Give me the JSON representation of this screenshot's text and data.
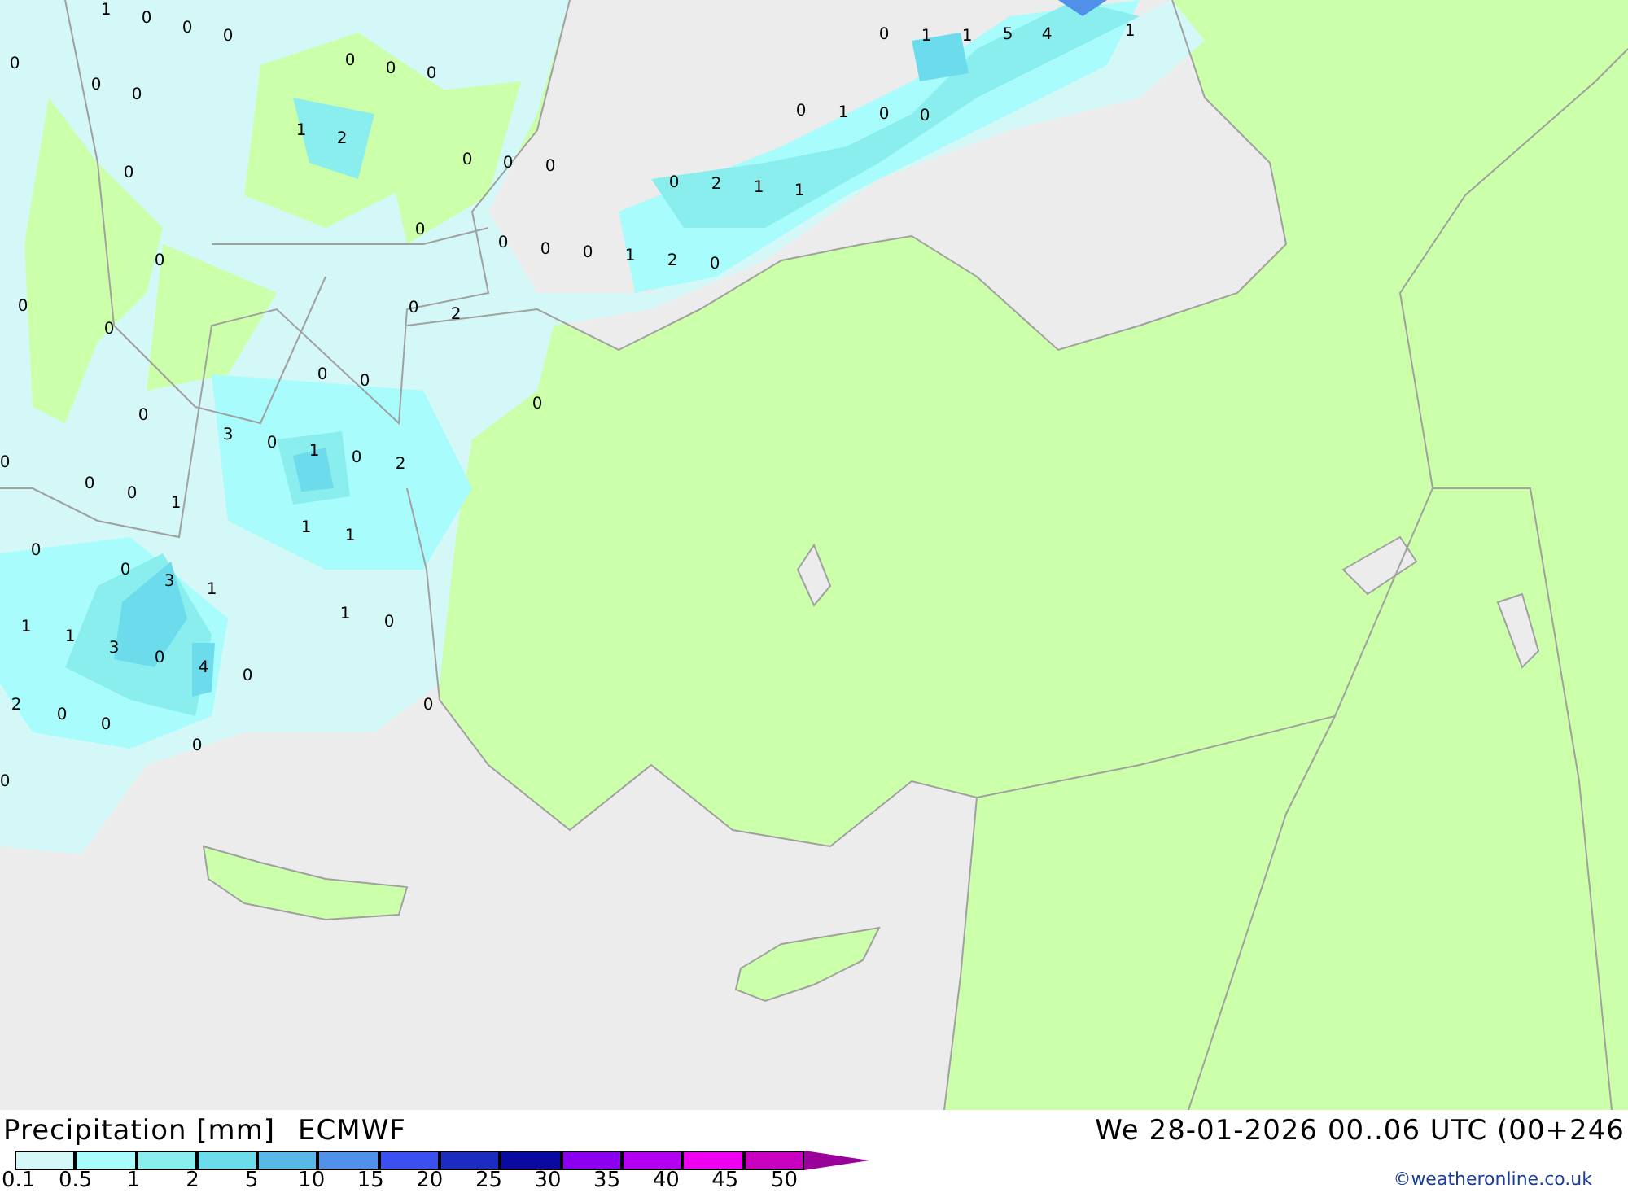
{
  "map": {
    "labels": [
      {
        "text": "1"
      },
      {
        "text": "0"
      },
      {
        "text": "0"
      },
      {
        "text": "0"
      },
      {
        "text": "0"
      },
      {
        "text": "0"
      },
      {
        "text": "0"
      },
      {
        "text": "1"
      },
      {
        "text": "2"
      },
      {
        "text": "0"
      },
      {
        "text": "0"
      },
      {
        "text": "0"
      },
      {
        "text": "0"
      },
      {
        "text": "0"
      },
      {
        "text": "0"
      },
      {
        "text": "0"
      },
      {
        "text": "0"
      },
      {
        "text": "0"
      },
      {
        "text": "0"
      },
      {
        "text": "0"
      },
      {
        "text": "0"
      },
      {
        "text": "2"
      },
      {
        "text": "0"
      },
      {
        "text": "0"
      },
      {
        "text": "0"
      },
      {
        "text": "0"
      },
      {
        "text": "1"
      },
      {
        "text": "1"
      },
      {
        "text": "5"
      },
      {
        "text": "4"
      },
      {
        "text": "1"
      },
      {
        "text": "0"
      },
      {
        "text": "1"
      },
      {
        "text": "0"
      },
      {
        "text": "0"
      },
      {
        "text": "0"
      },
      {
        "text": "2"
      },
      {
        "text": "1"
      },
      {
        "text": "1"
      },
      {
        "text": "0"
      },
      {
        "text": "0"
      },
      {
        "text": "0"
      },
      {
        "text": "1"
      },
      {
        "text": "2"
      },
      {
        "text": "0"
      },
      {
        "text": "0"
      },
      {
        "text": "0"
      },
      {
        "text": "3"
      },
      {
        "text": "0"
      },
      {
        "text": "1"
      },
      {
        "text": "0"
      },
      {
        "text": "2"
      },
      {
        "text": "0"
      },
      {
        "text": "0"
      },
      {
        "text": "1"
      },
      {
        "text": "0"
      },
      {
        "text": "1"
      },
      {
        "text": "1"
      },
      {
        "text": "0"
      },
      {
        "text": "3"
      },
      {
        "text": "1"
      },
      {
        "text": "1"
      },
      {
        "text": "1"
      },
      {
        "text": "3"
      },
      {
        "text": "0"
      },
      {
        "text": "4"
      },
      {
        "text": "0"
      },
      {
        "text": "1"
      },
      {
        "text": "0"
      },
      {
        "text": "2"
      },
      {
        "text": "0"
      },
      {
        "text": "0"
      },
      {
        "text": "0"
      },
      {
        "text": "0"
      },
      {
        "text": "0"
      }
    ]
  },
  "legend": {
    "title": "Precipitation [mm]",
    "model": "ECMWF",
    "valid_time": "We 28-01-2026 00..06 UTC (00+246",
    "credit": "©weatheronline.co.uk",
    "bins": [
      {
        "kind": "box",
        "color": "#d4f7f7"
      },
      {
        "kind": "box",
        "color": "#a8fcfc"
      },
      {
        "kind": "box",
        "color": "#8aeeee"
      },
      {
        "kind": "box",
        "color": "#6cdcec"
      },
      {
        "kind": "box",
        "color": "#5ab8e6"
      },
      {
        "kind": "box",
        "color": "#5090e8"
      },
      {
        "kind": "box",
        "color": "#3a50f0"
      },
      {
        "kind": "box",
        "color": "#1c2cc0"
      },
      {
        "kind": "box",
        "color": "#0a0aa0"
      },
      {
        "kind": "box",
        "color": "#8c00f0"
      },
      {
        "kind": "box",
        "color": "#b400f0"
      },
      {
        "kind": "box",
        "color": "#f000f0"
      },
      {
        "kind": "box",
        "color": "#c800c0"
      },
      {
        "kind": "arrow",
        "color": "#9a009a"
      }
    ],
    "ticks": [
      "0.1",
      "0.5",
      "1",
      "2",
      "5",
      "10",
      "15",
      "20",
      "25",
      "30",
      "35",
      "40",
      "45",
      "50"
    ]
  }
}
